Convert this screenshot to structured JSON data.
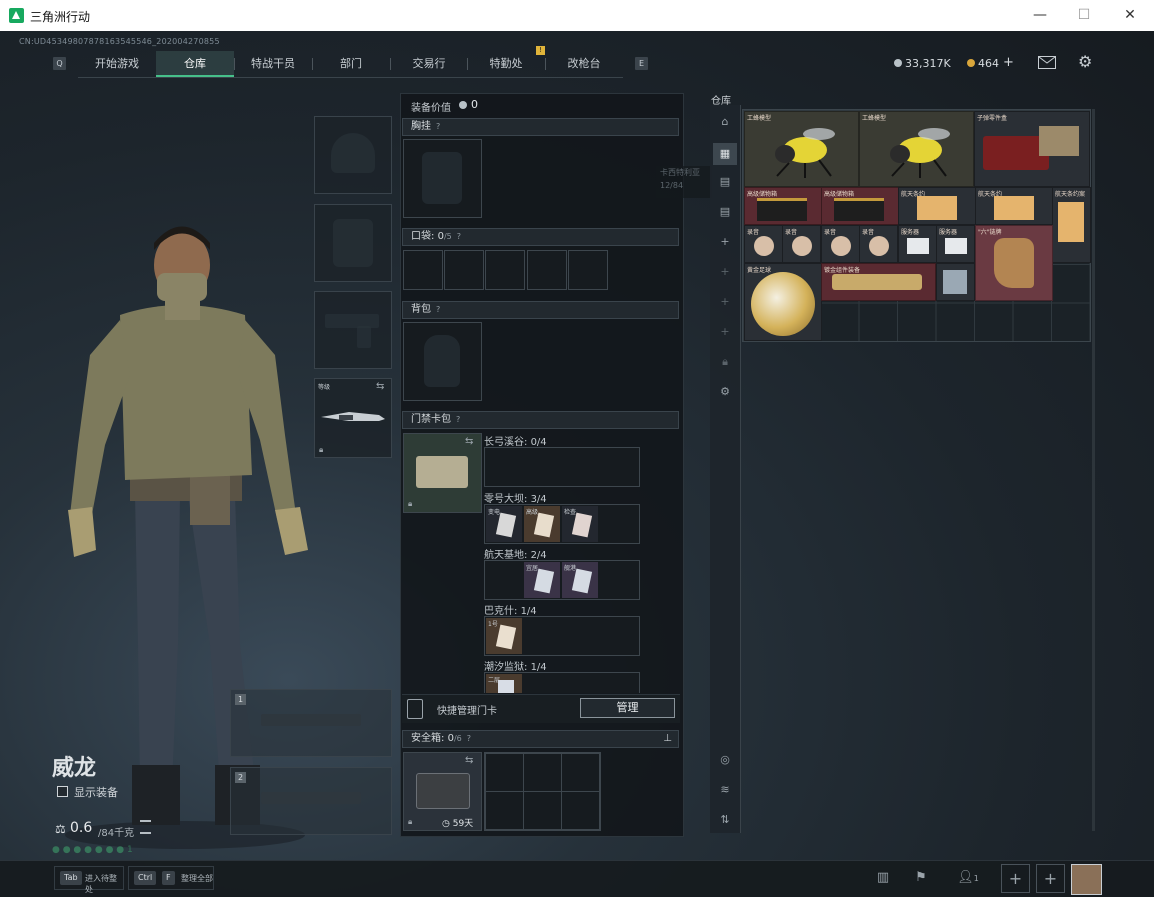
{
  "window": {
    "title": "三角洲行动",
    "controls": [
      "—",
      "☐",
      "✕"
    ]
  },
  "uid": "CN:UD45349807878163545546_202004270855",
  "nav": {
    "key_left": "Q",
    "key_right": "E",
    "tabs": [
      "开始游戏",
      "仓库",
      "特战干员",
      "部门",
      "交易行",
      "特勤处",
      "改枪台"
    ],
    "active_tab": 1,
    "badge": "!"
  },
  "currency": {
    "coin1": "33,317K",
    "coin2": "464",
    "plus": "+"
  },
  "character": {
    "name": "威龙",
    "show_equipment": "显示装备",
    "weight_value": "0.6",
    "weight_max": "/84千克",
    "faint_hint": "1"
  },
  "gear": {
    "melee_label": "等级",
    "slot1": "1",
    "slot2": "2"
  },
  "equipment": {
    "value_label": "装备价值",
    "value": "0",
    "chest_rig": "胸挂",
    "pockets": "口袋",
    "pockets_count": "0",
    "pockets_max": "/5",
    "backpack": "背包",
    "keycard_pack": "门禁卡包",
    "maps": [
      {
        "name": "长弓溪谷",
        "count": "0/4"
      },
      {
        "name": "零号大坝",
        "count": "3/4"
      },
      {
        "name": "航天基地",
        "count": "2/4"
      },
      {
        "name": "巴克什",
        "count": "1/4"
      },
      {
        "name": "潮汐监狱",
        "count": "1/4"
      }
    ],
    "card_labels": [
      "变电",
      "高级",
      "检查",
      "宜居",
      "舰港",
      "1号",
      "二层"
    ],
    "quick_manage": "快捷管理门卡",
    "manage_btn": "管理",
    "safe_box": "安全箱",
    "safe_count": "0",
    "safe_max": "/6",
    "safe_timer": "59天"
  },
  "tooltip": {
    "line1": "卡西特利亚",
    "line2": "12/84"
  },
  "warehouse": {
    "label": "仓库",
    "items": [
      "工蜂模型",
      "工蜂模型",
      "子弹零件盒",
      "高级储物箱",
      "高级储物箱",
      "航天条约",
      "航天条约",
      "航天条约案",
      "录音",
      "录音",
      "录音",
      "录音",
      "服务器",
      "服务器",
      "\"六\"链牌",
      "黄金足球",
      "镀金组件装备"
    ]
  },
  "bottom": {
    "tab_key": "Tab",
    "tab_label": "进入待整处",
    "ctrl_key": "Ctrl",
    "f_key": "F",
    "f_label": "整理全部",
    "friends": "1"
  }
}
